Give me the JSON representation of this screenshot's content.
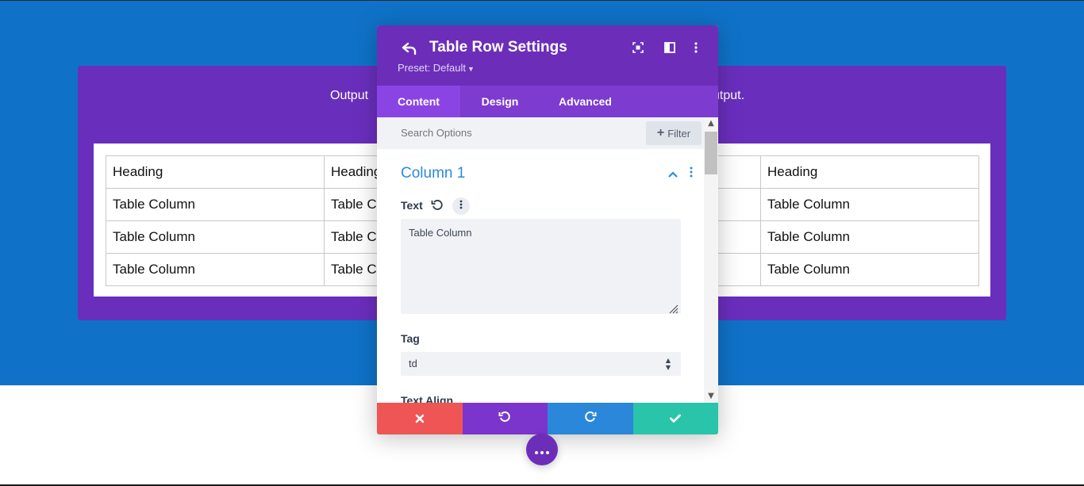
{
  "page": {
    "section_text_left": "Output",
    "section_text_right": "utput.",
    "table": {
      "rows": [
        [
          "Heading",
          "Heading",
          "Heading"
        ],
        [
          "Table Column",
          "Table C",
          "Table Column"
        ],
        [
          "Table Column",
          "Table C",
          "Table Column"
        ],
        [
          "Table Column",
          "Table C",
          "Table Column"
        ]
      ]
    }
  },
  "modal": {
    "title": "Table Row Settings",
    "preset_label": "Preset: Default",
    "tabs": [
      {
        "label": "Content",
        "active": true
      },
      {
        "label": "Design",
        "active": false
      },
      {
        "label": "Advanced",
        "active": false
      }
    ],
    "search": {
      "placeholder": "Search Options"
    },
    "filter_label": "Filter",
    "group": {
      "title": "Column 1",
      "fields": {
        "text_label": "Text",
        "text_value": "Table Column",
        "tag_label": "Tag",
        "tag_value": "td",
        "next_label": "Text Align"
      }
    },
    "footer": {
      "discard_icon": "close-icon",
      "undo_icon": "undo-icon",
      "redo_icon": "redo-icon",
      "save_icon": "check-icon"
    }
  },
  "colors": {
    "page_blue": "#0f72c8",
    "section_purple": "#6a2ebd",
    "modal_purple": "#6c2eb9",
    "discard_red": "#ef5555",
    "redo_blue": "#2b87da",
    "save_green": "#29c4a9",
    "accent_blue": "#2d8ae0"
  }
}
